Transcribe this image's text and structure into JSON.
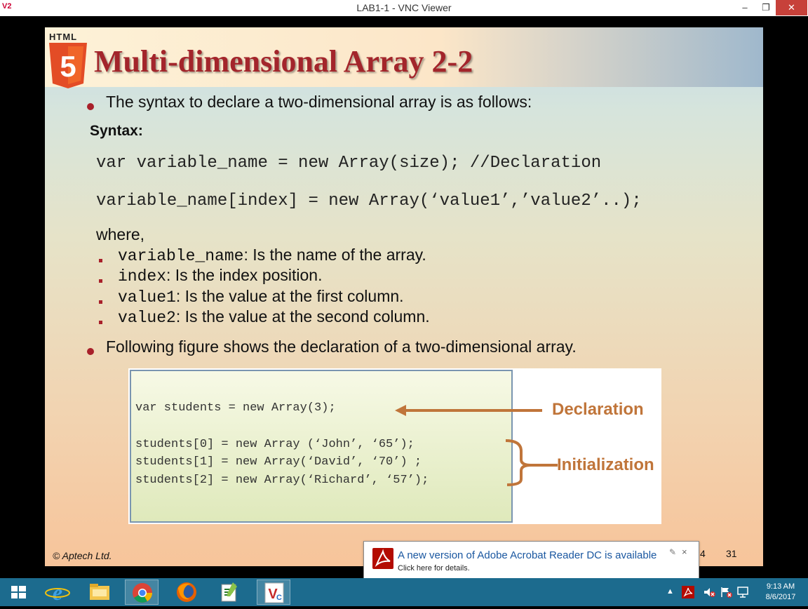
{
  "window": {
    "title": "LAB1-1 - VNC Viewer",
    "app_icon": "V2",
    "buttons": {
      "minimize": "–",
      "restore": "❐",
      "close": "✕"
    }
  },
  "slide": {
    "logo_text": "HTML",
    "logo_number": "5",
    "title": "Multi-dimensional Array 2-2",
    "bullet1": "The syntax to declare a two-dimensional array is as follows:",
    "syntax_label": "Syntax:",
    "code_line1": "var variable_name = new Array(size); //Declaration",
    "code_line2": "variable_name[index] = new Array(‘value1’,’value2’..);",
    "where": "where,",
    "defs": [
      {
        "term": "variable_name",
        "desc": ": Is the name of the array."
      },
      {
        "term": "index",
        "desc": ": Is the index position."
      },
      {
        "term": "value1",
        "desc": ": Is the value at the first column."
      },
      {
        "term": "value2",
        "desc": ": Is the value at the second column."
      }
    ],
    "bullet2": "Following figure shows the declaration of a two-dimensional array.",
    "figure": {
      "line1": "var students = new Array(3);",
      "line2": "students[0] = new Array (‘John’, ‘65’);",
      "line3": "students[1] = new Array(‘David’, ‘70’) ;",
      "line4": "students[2] = new Array(‘Richard’, ‘57’);",
      "declaration_label": "Declaration",
      "initialization_label": "Initialization"
    },
    "footer_left": "© Aptech Ltd.",
    "footer_mid": "4",
    "page_number": "31"
  },
  "notification": {
    "heading": "A new version of Adobe Acrobat Reader DC is available",
    "sub": "Click here for details.",
    "close": "×"
  },
  "taskbar": {
    "time": "9:13 AM",
    "date": "8/6/2017",
    "tray_arrow": "▲"
  },
  "colors": {
    "title_red": "#a3252b",
    "bullet_red": "#a8202a",
    "annotation_orange": "#c0753a",
    "taskbar": "#1c6b8e",
    "link_blue": "#1a57a0"
  }
}
